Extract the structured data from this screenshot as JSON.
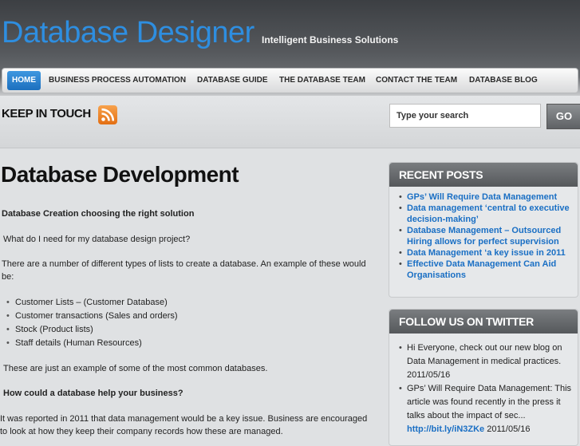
{
  "site": {
    "title": "Database Designer",
    "tagline": "Intelligent Business Solutions"
  },
  "nav": [
    "HOME",
    "BUSINESS PROCESS AUTOMATION",
    "DATABASE GUIDE",
    "THE DATABASE TEAM",
    "CONTACT THE TEAM",
    "DATABASE BLOG"
  ],
  "keep_in_touch": "KEEP IN TOUCH",
  "search": {
    "placeholder": "Type your search",
    "button": "GO"
  },
  "main": {
    "heading": "Database Development",
    "subheading": "Database Creation choosing the right solution",
    "question": "What do I need for my database design project?",
    "intro": "There are a number of different types of lists to create a database. An example of these would be:",
    "list": [
      "Customer Lists – (Customer Database)",
      "Customer transactions (Sales and orders)",
      "Stock (Product lists)",
      "Staff details (Human Resources)"
    ],
    "examples_note": "These are just an example of some of the most common databases.",
    "help_heading": "How could a database help your business?",
    "report": "It was reported in 2011 that data management would be a key issue. Business are encouraged to look at how they keep their company records how these are managed."
  },
  "sidebar": {
    "recent_posts": {
      "title": "RECENT POSTS",
      "items": [
        "GPs’ Will Require Data Management",
        "Data management ‘central to executive decision-making’",
        "Database Management – Outsourced Hiring allows for perfect supervision",
        "Data Management ‘a key issue in 2011",
        "Effective Data Management Can Aid Organisations"
      ]
    },
    "twitter": {
      "title": "FOLLOW US ON TWITTER",
      "tweets": [
        {
          "text": "Hi Everyone, check out our new blog on Data Management in medical practices.",
          "date": "2011/05/16"
        },
        {
          "text": "GPs’ Will Require Data Management: This article was found recently in the press it talks about the impact of sec...",
          "link": "http://bit.ly/iN3ZKe",
          "date": "2011/05/16"
        }
      ]
    }
  },
  "colors": {
    "brand_blue": "#2e8ee0",
    "link_blue": "#1a6fc4",
    "rss_orange": "#f08a24"
  }
}
